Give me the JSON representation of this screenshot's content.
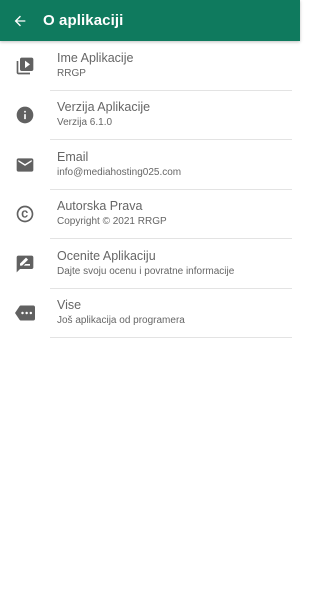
{
  "appbar": {
    "title": "O aplikaciji",
    "back_icon": "arrow-left-icon",
    "background": "#0f7a5e"
  },
  "items": [
    {
      "icon": "video-library-icon",
      "title": "Ime Aplikacije",
      "subtitle": "RRGP"
    },
    {
      "icon": "info-icon",
      "title": "Verzija Aplikacije",
      "subtitle": "Verzija 6.1.0"
    },
    {
      "icon": "email-icon",
      "title": "Email",
      "subtitle": "info@mediahosting025.com"
    },
    {
      "icon": "copyright-icon",
      "title": "Autorska Prava",
      "subtitle": "Copyright © 2021 RRGP"
    },
    {
      "icon": "rate-review-icon",
      "title": "Ocenite Aplikaciju",
      "subtitle": "Dajte svoju ocenu i povratne informacije"
    },
    {
      "icon": "more-icon",
      "title": "Vise",
      "subtitle": "Još aplikacija od programera"
    }
  ]
}
